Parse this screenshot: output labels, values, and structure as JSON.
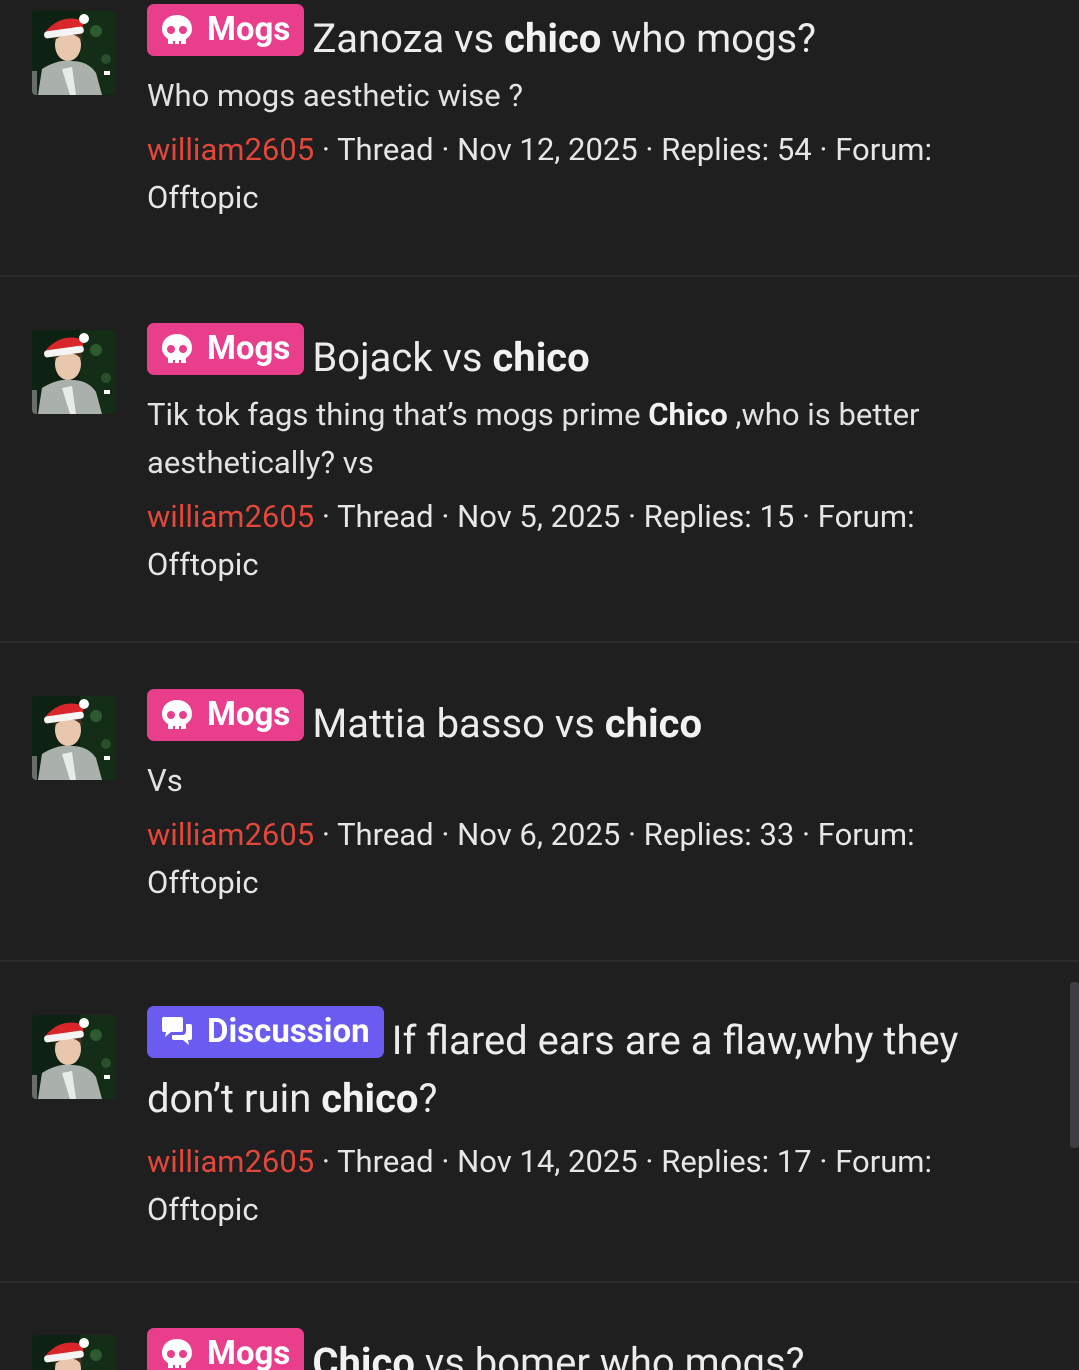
{
  "results": [
    {
      "prefix": {
        "label": "Mogs",
        "icon": "skull-icon",
        "color": "#e83e8c"
      },
      "title_parts": [
        "Zanoza vs ",
        "chico",
        " who mogs?"
      ],
      "snippet_parts": [
        "Who mogs aesthetic wise ?",
        "",
        ""
      ],
      "user": "william2605",
      "meta_parts": [
        "Thread",
        "Nov 12, 2025",
        "Replies: 54",
        "Forum:",
        "Offtopic"
      ]
    },
    {
      "prefix": {
        "label": "Mogs",
        "icon": "skull-icon",
        "color": "#e83e8c"
      },
      "title_parts": [
        "Bojack vs ",
        "chico",
        ""
      ],
      "snippet_parts": [
        "Tik tok fags thing that’s mogs prime ",
        "Chico",
        " ,who is better aesthetically? vs"
      ],
      "user": "william2605",
      "meta_parts": [
        "Thread",
        "Nov 5, 2025",
        "Replies: 15",
        "Forum:",
        "Offtopic"
      ]
    },
    {
      "prefix": {
        "label": "Mogs",
        "icon": "skull-icon",
        "color": "#e83e8c"
      },
      "title_parts": [
        "Mattia basso vs ",
        "chico",
        ""
      ],
      "snippet_parts": [
        "Vs",
        "",
        ""
      ],
      "user": "william2605",
      "meta_parts": [
        "Thread",
        "Nov 6, 2025",
        "Replies: 33",
        "Forum:",
        "Offtopic"
      ]
    },
    {
      "prefix": {
        "label": "Discussion",
        "icon": "comments-icon",
        "color": "#6a5cf0"
      },
      "title_parts": [
        "If flared ears are a flaw,why they don’t ruin ",
        "chico",
        "?"
      ],
      "snippet_parts": [
        "",
        "",
        ""
      ],
      "user": "william2605",
      "meta_parts": [
        "Thread",
        "Nov 14, 2025",
        "Replies: 17",
        "Forum:",
        "Offtopic"
      ]
    },
    {
      "prefix": {
        "label": "Mogs",
        "icon": "skull-icon",
        "color": "#e83e8c"
      },
      "title_parts": [
        "",
        "Chico",
        " vs bomer who mogs?"
      ],
      "snippet_parts": [
        "",
        "",
        ""
      ],
      "user": "",
      "meta_parts": [
        "",
        "",
        "",
        "",
        ""
      ]
    }
  ],
  "separator": " · "
}
